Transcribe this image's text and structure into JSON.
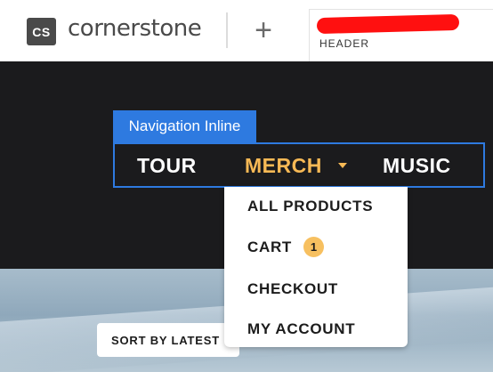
{
  "app": {
    "logo_mark": "CS",
    "logo_text": "cornerstone",
    "add_button_label": "+",
    "header_tab_label": "HEADER"
  },
  "navigation": {
    "element_label": "Navigation Inline",
    "items": [
      {
        "label": "TOUR"
      },
      {
        "label": "MERCH",
        "active": true
      },
      {
        "label": "MUSIC"
      }
    ],
    "accent_color": "#2e7ae0",
    "active_color": "#f7b955"
  },
  "dropdown": {
    "items": [
      {
        "label": "ALL PRODUCTS"
      },
      {
        "label": "CART",
        "badge": "1"
      },
      {
        "label": "CHECKOUT"
      },
      {
        "label": "MY ACCOUNT"
      }
    ]
  },
  "shop": {
    "sort_label": "SORT BY LATEST"
  },
  "icons": {
    "plus": "plus-icon",
    "caret": "caret-down-icon"
  }
}
